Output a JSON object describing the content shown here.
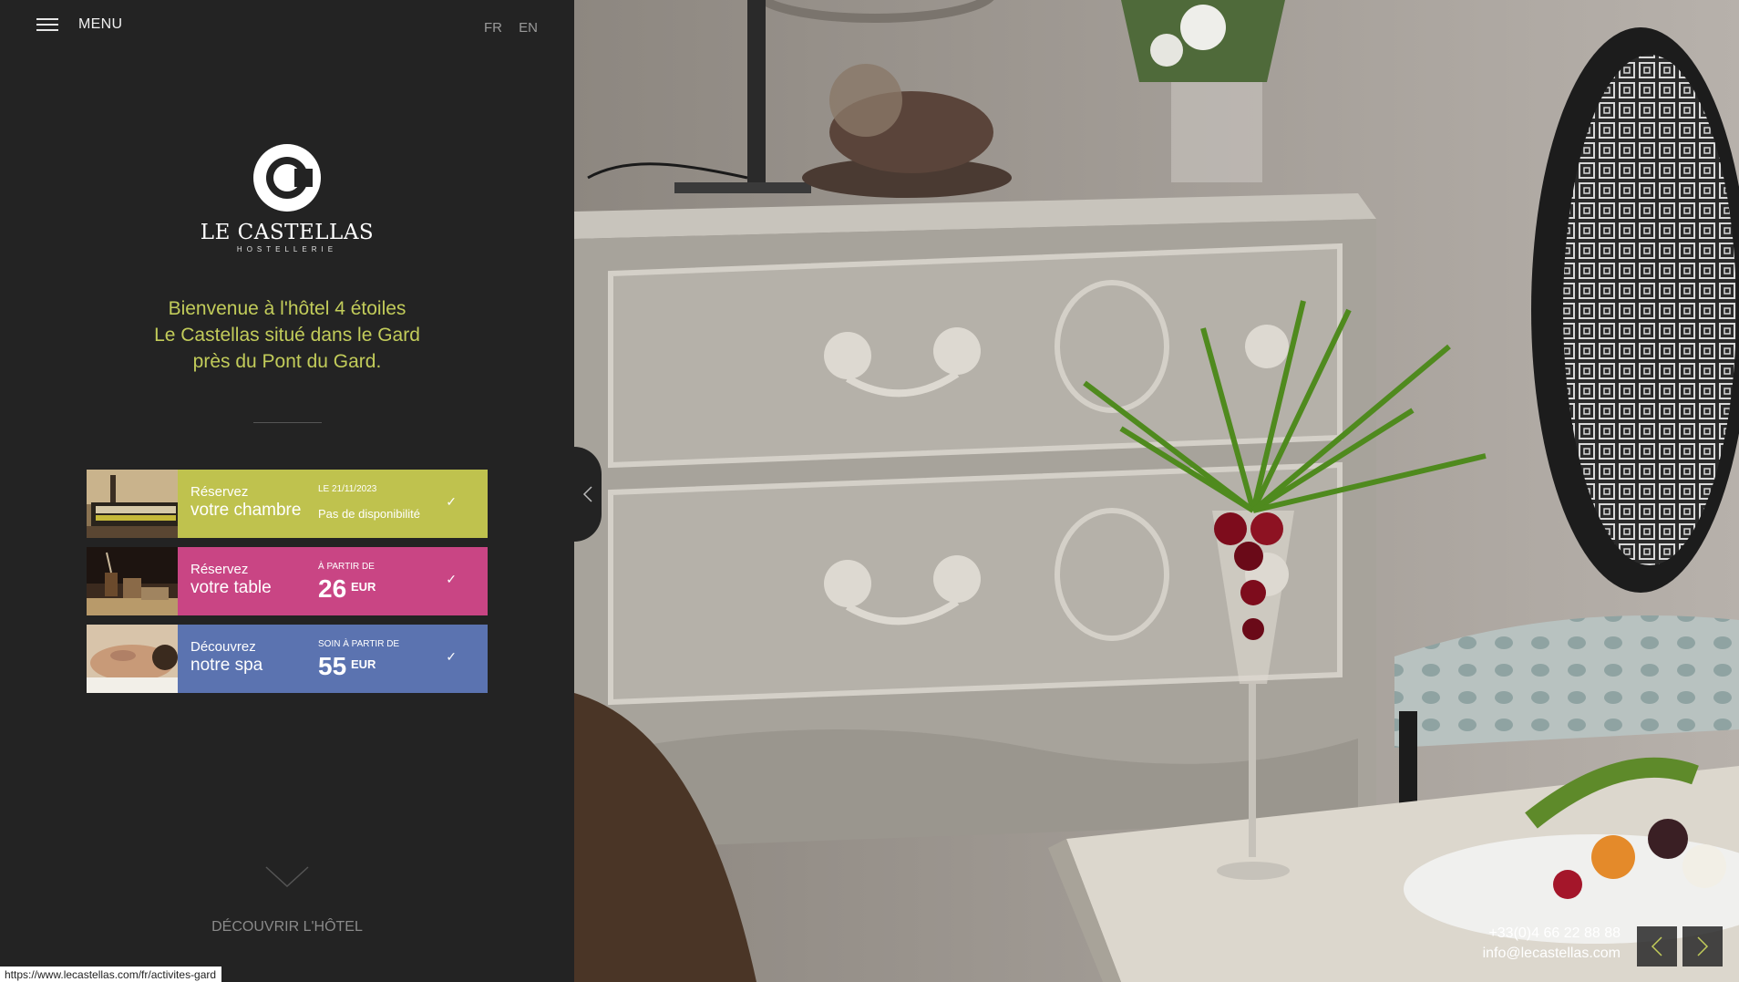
{
  "header": {
    "menu_label": "MENU",
    "languages": [
      "FR",
      "EN"
    ]
  },
  "logo": {
    "title": "LE CASTELLAS",
    "subtitle": "HOSTELLERIE"
  },
  "welcome": {
    "lines": [
      "Bienvenue à l'hôtel 4 étoiles",
      "Le Castellas situé dans le Gard",
      "près du Pont du Gard."
    ]
  },
  "cards": [
    {
      "line1": "Réservez",
      "line2": "votre chambre",
      "label": "LE 21/11/2023",
      "value": "Pas de disponibilité",
      "color": "#bfc24e"
    },
    {
      "line1": "Réservez",
      "line2": "votre table",
      "label": "À PARTIR DE",
      "price": "26",
      "currency": "EUR",
      "color": "#c94584"
    },
    {
      "line1": "Découvrez",
      "line2": "notre spa",
      "label": "SOIN À PARTIR DE",
      "price": "55",
      "currency": "EUR",
      "color": "#5b73b0"
    }
  ],
  "discover_label": "DÉCOUVRIR L'HÔTEL",
  "status_url": "https://www.lecastellas.com/fr/activites-gard",
  "contact": {
    "phone": "+33(0)4 66 22 88 88",
    "email": "info@lecastellas.com"
  },
  "icons": {
    "menu": "hamburger-icon",
    "check": "check-icon",
    "collapse": "chevron-left-icon",
    "prev": "chevron-left-icon",
    "next": "chevron-right-icon",
    "discover": "chevron-down-icon"
  }
}
